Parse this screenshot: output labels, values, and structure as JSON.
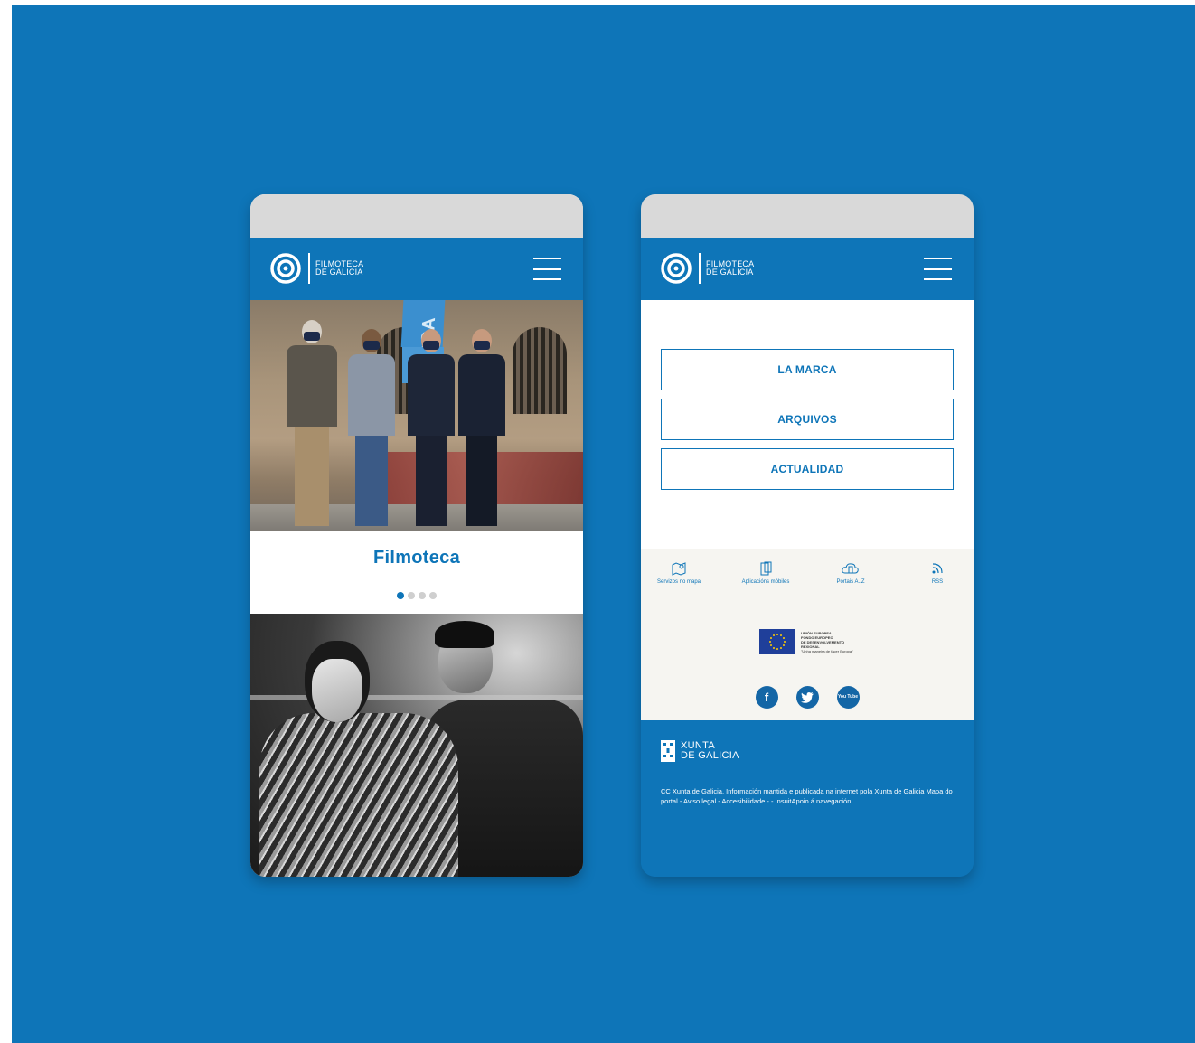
{
  "brand": {
    "line1": "FILMOTECA",
    "line2": "DE GALICIA"
  },
  "left_phone": {
    "slide_title": "Filmoteca",
    "banner_text": "CGA",
    "dots": 4,
    "active_dot": 1
  },
  "right_phone": {
    "menu_items": [
      "LA MARCA",
      "ARQUIVOS",
      "ACTUALIDAD"
    ],
    "services": [
      {
        "label": "Servizos no mapa",
        "icon": "map-pin-icon"
      },
      {
        "label": "Aplicacións móbiles",
        "icon": "mobile-apps-icon"
      },
      {
        "label": "Portais A..Z",
        "icon": "portal-cloud-icon"
      },
      {
        "label": "RSS",
        "icon": "rss-icon"
      }
    ],
    "eu_text": [
      "UNIÓN EUROPEA",
      "FONDO EUROPEO",
      "DE DESENVOLVEMENTO",
      "REXIONAL",
      "\"Unha maneira de facer Europa\""
    ],
    "social": [
      {
        "label": "f",
        "icon": "facebook-icon"
      },
      {
        "label": "t",
        "icon": "twitter-icon"
      },
      {
        "label": "You Tube",
        "icon": "youtube-icon"
      }
    ],
    "xunta": {
      "line1": "XUNTA",
      "line2": "DE GALICIA"
    },
    "footer_text": "CC Xunta de Galicia. Información mantida e publicada na internet pola Xunta de Galicia Mapa do portal - Aviso legal - Accesibilidade -  - InsuitApoio á navegación"
  },
  "colors": {
    "brand_blue": "#0e75b8",
    "status_gray": "#d9d9d9",
    "services_bg": "#f6f5f1"
  }
}
